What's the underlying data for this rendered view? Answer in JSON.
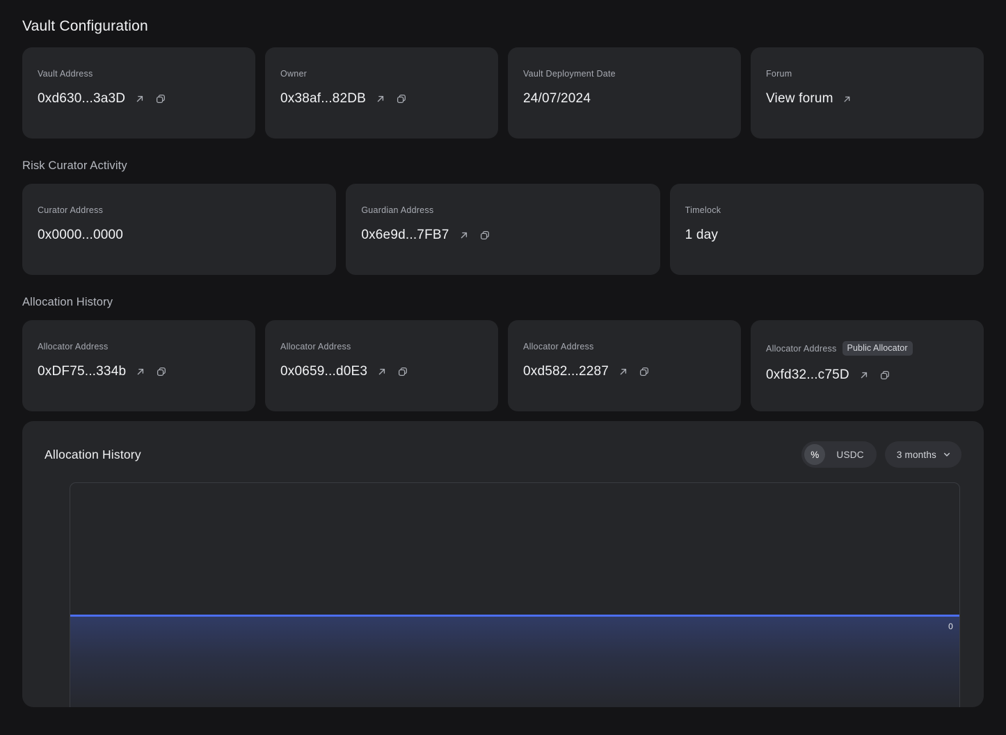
{
  "page": {
    "title": "Vault Configuration"
  },
  "sections": {
    "vault_config": {
      "cards": [
        {
          "label": "Vault Address",
          "value": "0xd630...3a3D",
          "external": true,
          "copy": true
        },
        {
          "label": "Owner",
          "value": "0x38af...82DB",
          "external": true,
          "copy": true
        },
        {
          "label": "Vault Deployment Date",
          "value": "24/07/2024",
          "external": false,
          "copy": false
        },
        {
          "label": "Forum",
          "value": "View forum",
          "external": true,
          "copy": false
        }
      ]
    },
    "risk_curator": {
      "title": "Risk Curator Activity",
      "cards": [
        {
          "label": "Curator Address",
          "value": "0x0000...0000",
          "external": false,
          "copy": false
        },
        {
          "label": "Guardian Address",
          "value": "0x6e9d...7FB7",
          "external": true,
          "copy": true
        },
        {
          "label": "Timelock",
          "value": "1 day",
          "external": false,
          "copy": false
        }
      ]
    },
    "allocation_history": {
      "title": "Allocation History",
      "cards": [
        {
          "label": "Allocator Address",
          "value": "0xDF75...334b",
          "badge": "",
          "external": true,
          "copy": true
        },
        {
          "label": "Allocator Address",
          "value": "0x0659...d0E3",
          "badge": "",
          "external": true,
          "copy": true
        },
        {
          "label": "Allocator Address",
          "value": "0xd582...2287",
          "badge": "",
          "external": true,
          "copy": true
        },
        {
          "label": "Allocator Address",
          "value": "0xfd32...c75D",
          "badge": "Public Allocator",
          "external": true,
          "copy": true
        }
      ]
    }
  },
  "chart_panel": {
    "title": "Allocation History",
    "unit_toggle": {
      "options": [
        "%",
        "USDC"
      ],
      "selected": "%"
    },
    "range_dropdown": {
      "selected": "3 months",
      "chevron": "chevron-down-icon"
    }
  },
  "chart_data": {
    "type": "area",
    "title": "Allocation History",
    "series": [
      {
        "name": "0",
        "values": [
          0,
          0,
          0,
          0,
          0,
          0,
          0,
          0,
          0,
          0,
          0,
          0
        ],
        "color": "#4c6ef0"
      }
    ],
    "x": [
      "",
      "",
      "",
      "",
      "",
      "",
      "",
      "",
      "",
      "",
      "",
      ""
    ],
    "annotations": [
      "0"
    ],
    "ylabel": "",
    "xlabel": "",
    "unit": "%",
    "range": "3 months",
    "ylim": [
      0,
      100
    ],
    "grid": false,
    "legend": "none"
  },
  "colors": {
    "accent": "#4c6ef0",
    "card_bg": "#252629",
    "page_bg": "#141416"
  }
}
